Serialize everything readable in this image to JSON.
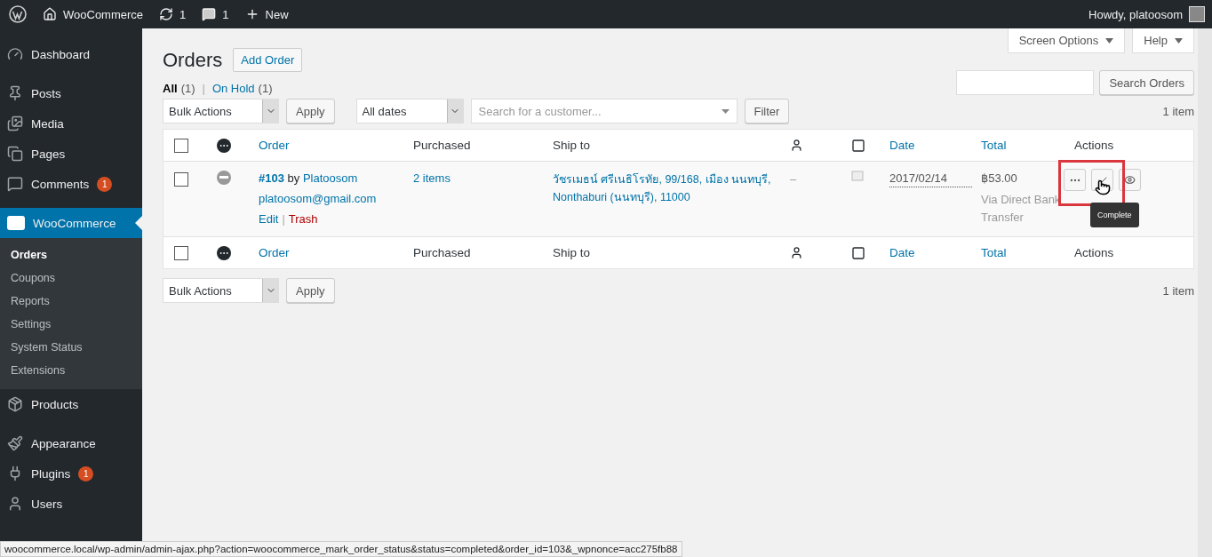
{
  "admin_bar": {
    "site": "WooCommerce",
    "updates": "1",
    "comments": "1",
    "new": "New",
    "greeting": "Howdy, platoosom"
  },
  "sidebar": {
    "items": [
      {
        "label": "Dashboard",
        "selected": false
      },
      {
        "label": "Posts",
        "selected": false
      },
      {
        "label": "Media",
        "selected": false
      },
      {
        "label": "Pages",
        "selected": false
      },
      {
        "label": "Comments",
        "badge": "1",
        "selected": false
      },
      {
        "label": "WooCommerce",
        "selected": true,
        "children": [
          {
            "label": "Orders",
            "selected": true
          },
          {
            "label": "Coupons",
            "selected": false
          },
          {
            "label": "Reports",
            "selected": false
          },
          {
            "label": "Settings",
            "selected": false
          },
          {
            "label": "System Status",
            "selected": false
          },
          {
            "label": "Extensions",
            "selected": false
          }
        ]
      },
      {
        "label": "Products",
        "selected": false
      },
      {
        "label": "Appearance",
        "selected": false
      },
      {
        "label": "Plugins",
        "badge": "1",
        "selected": false
      },
      {
        "label": "Users",
        "selected": false
      }
    ]
  },
  "screen_meta": [
    "Screen Options",
    "Help"
  ],
  "title": "Orders",
  "add_button": "Add Order",
  "views": [
    {
      "label": "All",
      "count": "(1)",
      "selected": true
    },
    {
      "label": "On Hold",
      "count": "(1)",
      "selected": false
    }
  ],
  "view_separator": "|",
  "search_button": "Search Orders",
  "top_nav": {
    "bulk": "Bulk Actions",
    "apply": "Apply",
    "dates": "All dates",
    "customer_placeholder": "Search for a customer...",
    "filter": "Filter",
    "count": "1 item"
  },
  "table": {
    "header": [
      {
        "kind": "checkbox",
        "checked": false
      },
      {
        "kind": "status"
      },
      {
        "kind": "link",
        "label": "Order"
      },
      {
        "kind": "text",
        "label": "Purchased"
      },
      {
        "kind": "text",
        "label": "Ship to"
      },
      {
        "kind": "billing"
      },
      {
        "kind": "notes"
      },
      {
        "kind": "link",
        "label": "Date"
      },
      {
        "kind": "link",
        "label": "Total"
      },
      {
        "kind": "text",
        "label": "Actions"
      }
    ],
    "rows": [
      {
        "checked": false,
        "order": "#103",
        "by": "by",
        "customer": "Platoosom",
        "email": "platoosom@gmail.com",
        "row_actions": [
          {
            "kind": "edit",
            "label": "Edit"
          },
          {
            "kind": "trash",
            "label": "Trash"
          }
        ],
        "row_action_separator": "|",
        "purchased": "2 items",
        "ship_to": "วัชรเมธน์ ศรีเนธิโรทัย, 99/168, เมือง นนทบุรี, Nonthaburi (นนทบุรี), 11000",
        "billing": "–",
        "date": "2017/02/14",
        "total": "฿53.00",
        "payment": "Via Direct Bank Transfer",
        "actions": [
          {
            "kind": "more"
          },
          {
            "kind": "complete"
          },
          {
            "kind": "view"
          }
        ],
        "tooltip": "Complete"
      }
    ],
    "footer": [
      {
        "kind": "checkbox",
        "checked": false
      },
      {
        "kind": "status"
      },
      {
        "kind": "link",
        "label": "Order"
      },
      {
        "kind": "text",
        "label": "Purchased"
      },
      {
        "kind": "text",
        "label": "Ship to"
      },
      {
        "kind": "billing"
      },
      {
        "kind": "notes"
      },
      {
        "kind": "link",
        "label": "Date"
      },
      {
        "kind": "link",
        "label": "Total"
      },
      {
        "kind": "text",
        "label": "Actions"
      }
    ]
  },
  "bottom_nav": {
    "bulk": "Bulk Actions",
    "apply": "Apply",
    "count": "1 item"
  },
  "status_bar": "woocommerce.local/wp-admin/admin-ajax.php?action=woocommerce_mark_order_status&status=completed&order_id=103&_wpnonce=acc275fb88"
}
